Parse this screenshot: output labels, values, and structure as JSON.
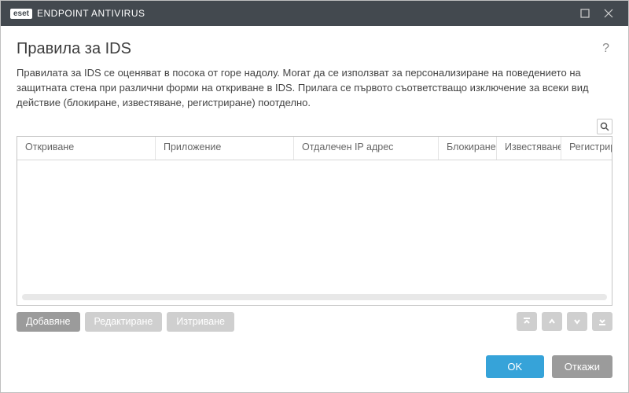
{
  "titlebar": {
    "brand_logo": "eset",
    "brand_text": "ENDPOINT ANTIVIRUS"
  },
  "page": {
    "title": "Правила за IDS",
    "description": "Правилата за IDS се оценяват в посока от горе надолу. Могат да се използват за персонализиране на поведението на защитната стена при различни форми на откриване в IDS. Прилага се първото съответстващо изключение за всеки вид действие (блокиране, известяване, регистриране) поотделно."
  },
  "table": {
    "columns": {
      "detection": "Откриване",
      "application": "Приложение",
      "remote_ip": "Отдалечен IP адрес",
      "block": "Блокиране",
      "notify": "Известяване",
      "log": "Регистриране"
    },
    "rows": []
  },
  "toolbar": {
    "add": "Добавяне",
    "edit": "Редактиране",
    "delete": "Изтриване"
  },
  "footer": {
    "ok": "OK",
    "cancel": "Откажи"
  }
}
